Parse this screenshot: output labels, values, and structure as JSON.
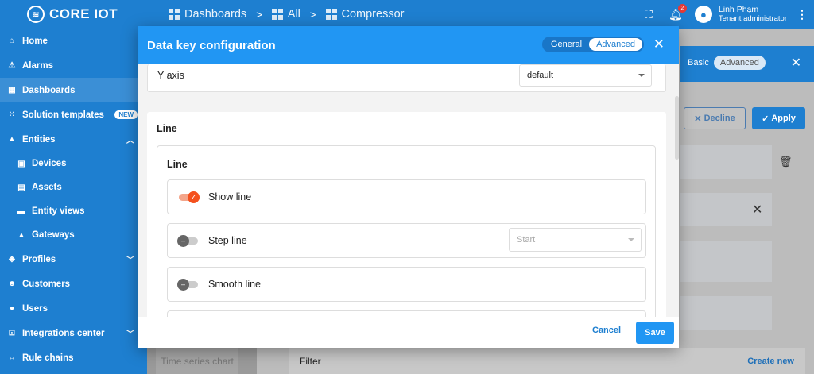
{
  "header": {
    "logo_text": "CORE IOT",
    "breadcrumbs": [
      {
        "label": "Dashboards",
        "icon": "dashboard-icon"
      },
      {
        "label": "All",
        "icon": "dashboard-icon"
      },
      {
        "label": "Compressor",
        "icon": "dashboard-icon"
      }
    ],
    "separator": ">",
    "notifications_count": "2",
    "user_name": "Linh Phạm",
    "user_role": "Tenant administrator"
  },
  "sidebar": {
    "items": [
      {
        "label": "Home",
        "icon": "home-icon"
      },
      {
        "label": "Alarms",
        "icon": "warning-icon"
      },
      {
        "label": "Dashboards",
        "icon": "dashboard-icon",
        "active": true
      },
      {
        "label": "Solution templates",
        "icon": "grid-icon",
        "badge": "NEW"
      },
      {
        "label": "Entities",
        "icon": "entities-icon",
        "expanded": true
      },
      {
        "label": "Devices",
        "icon": "device-icon",
        "sub": true
      },
      {
        "label": "Assets",
        "icon": "asset-icon",
        "sub": true
      },
      {
        "label": "Entity views",
        "icon": "view-icon",
        "sub": true
      },
      {
        "label": "Gateways",
        "icon": "gateway-icon",
        "sub": true
      },
      {
        "label": "Profiles",
        "icon": "profile-icon",
        "expanded": false
      },
      {
        "label": "Customers",
        "icon": "customers-icon"
      },
      {
        "label": "Users",
        "icon": "user-icon"
      },
      {
        "label": "Integrations center",
        "icon": "integration-icon",
        "expanded": false
      },
      {
        "label": "Rule chains",
        "icon": "rule-chain-icon"
      }
    ]
  },
  "background": {
    "mode_basic": "Basic",
    "mode_advanced": "Advanced",
    "decline_label": "Decline",
    "apply_label": "Apply",
    "widget_card": "Time series chart",
    "filter_label": "Filter",
    "create_new": "Create new"
  },
  "dialog": {
    "title": "Data key configuration",
    "mode_general": "General",
    "mode_advanced": "Advanced",
    "y_axis_label": "Y axis",
    "y_axis_value": "default",
    "section_title": "Line",
    "inner_title": "Line",
    "options": [
      {
        "label": "Show line",
        "on": true
      },
      {
        "label": "Step line",
        "on": false,
        "select": "Start"
      },
      {
        "label": "Smooth line",
        "on": false
      }
    ],
    "cancel_label": "Cancel",
    "save_label": "Save"
  },
  "colors": {
    "primary": "#2196f3",
    "sidebar": "#1e7fd0",
    "toggle_on": "#f4511e"
  }
}
